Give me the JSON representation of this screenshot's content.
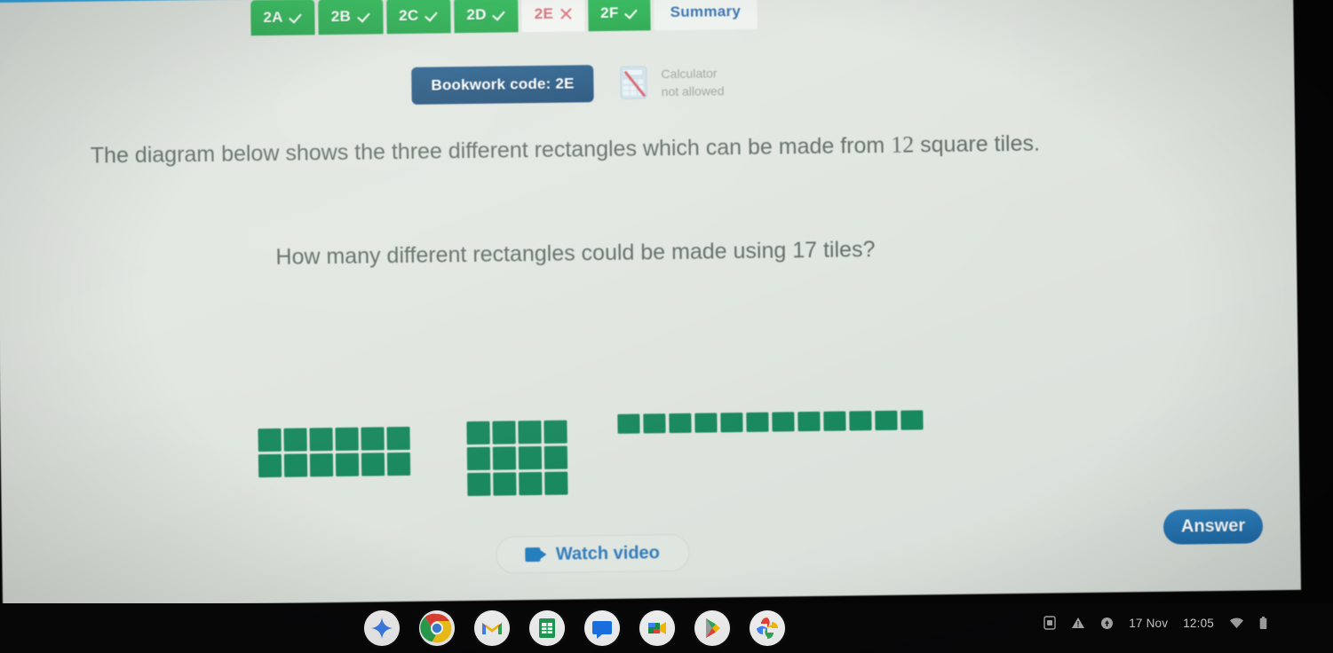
{
  "tabs": [
    {
      "label": "2A",
      "state": "correct",
      "icon": "check-icon"
    },
    {
      "label": "2B",
      "state": "correct",
      "icon": "check-icon"
    },
    {
      "label": "2C",
      "state": "correct",
      "icon": "check-icon"
    },
    {
      "label": "2D",
      "state": "correct",
      "icon": "check-icon"
    },
    {
      "label": "2E",
      "state": "current-incorrect",
      "icon": "cross-icon"
    },
    {
      "label": "2F",
      "state": "correct",
      "icon": "check-icon"
    },
    {
      "label": "Summary",
      "state": "summary",
      "icon": ""
    }
  ],
  "bookwork": {
    "code_label": "Bookwork code: 2E"
  },
  "calculator": {
    "icon": "calculator-icon",
    "line1": "Calculator",
    "line2": "not allowed"
  },
  "question": {
    "line1_a": "The diagram below shows the three different rectangles which can be made from",
    "line1_b": "12",
    "line1_c": "square tiles.",
    "line2_a": "How many different rectangles could be made using",
    "line2_b": "17",
    "line2_c": "tiles?"
  },
  "diagrams": {
    "tile_color": "#128a5d",
    "rectangles": [
      {
        "name": "rectangle-6x2",
        "cols": 6,
        "rows": 2,
        "tiles": 12
      },
      {
        "name": "rectangle-4x3",
        "cols": 4,
        "rows": 3,
        "tiles": 12
      },
      {
        "name": "rectangle-12x1",
        "cols": 12,
        "rows": 1,
        "tiles": 12
      }
    ]
  },
  "actions": {
    "watch_video": "Watch video",
    "video_icon": "video-camera-icon",
    "answer": "Answer"
  },
  "shelf": {
    "apps": [
      {
        "name": "gemini-icon",
        "label": "Gemini"
      },
      {
        "name": "chrome-icon",
        "label": "Chrome"
      },
      {
        "name": "gmail-icon",
        "label": "Gmail"
      },
      {
        "name": "sheets-icon",
        "label": "Sheets"
      },
      {
        "name": "chat-icon",
        "label": "Chat"
      },
      {
        "name": "meet-icon",
        "label": "Meet"
      },
      {
        "name": "play-store-icon",
        "label": "Play Store"
      },
      {
        "name": "photos-icon",
        "label": "Photos"
      }
    ],
    "tray": {
      "screenshot_icon": "screen-capture-icon",
      "warning_icon": "warning-triangle-icon",
      "update_icon": "update-circle-icon",
      "date": "17 Nov",
      "time": "12:05",
      "wifi_icon": "wifi-icon",
      "battery_icon": "battery-icon"
    }
  },
  "colors": {
    "tab_green": "#22b14c",
    "bookwork_blue": "#205687",
    "answer_blue": "#1f75b8",
    "link_blue": "#2f7fc0",
    "tile_green": "#128a5d",
    "incorrect_red": "#d36b74",
    "page_bg": "#dfe4df"
  }
}
